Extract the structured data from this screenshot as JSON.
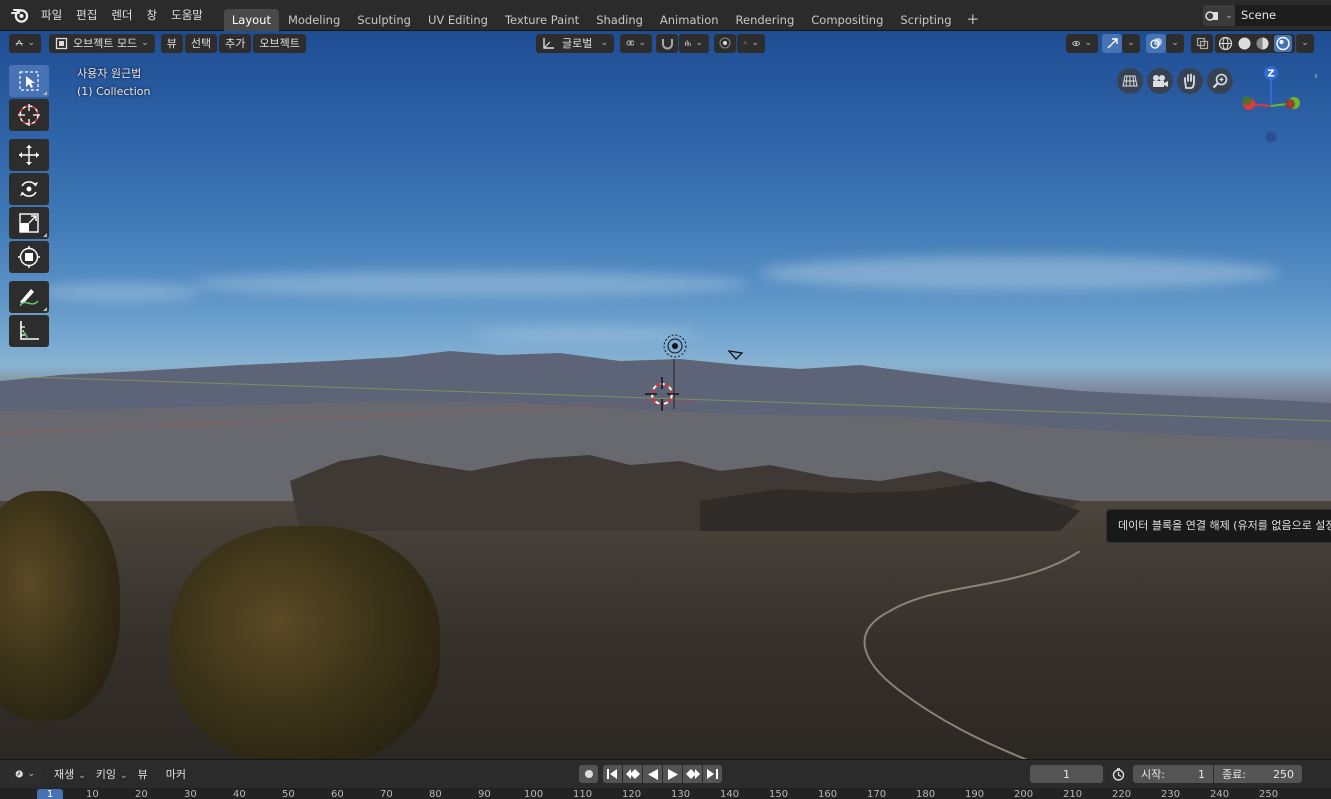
{
  "menu": {
    "items": [
      "파일",
      "편집",
      "렌더",
      "창",
      "도움말"
    ]
  },
  "workspaces": {
    "tabs": [
      "Layout",
      "Modeling",
      "Sculpting",
      "UV Editing",
      "Texture Paint",
      "Shading",
      "Animation",
      "Rendering",
      "Compositing",
      "Scripting"
    ],
    "active": "Layout",
    "add_label": "+"
  },
  "scene": {
    "name": "Scene"
  },
  "viewport_header": {
    "mode": "오브젝트 모드",
    "view": "뷰",
    "select": "선택",
    "add": "추가",
    "object": "오브젝트",
    "transform_orientation": "글로벌"
  },
  "viewport_overlay": {
    "view_name": "사용자 원근법",
    "collection": "(1) Collection"
  },
  "gizmo": {
    "z_label": "Z",
    "colors": {
      "x": "#e0383e",
      "y": "#6bb82b",
      "z": "#2f6ed6"
    }
  },
  "tooltip": {
    "text": "데이터 블록을 연결 해제 (유저를 없음으로 설정)"
  },
  "timeline": {
    "menu": {
      "playback": "재생",
      "keying": "키잉",
      "view": "뷰",
      "marker": "마커"
    },
    "current_frame": "1",
    "start_label": "시작:",
    "start": "1",
    "end_label": "종료:",
    "end": "250",
    "ruler_ticks": [
      "1",
      "10",
      "20",
      "30",
      "40",
      "50",
      "60",
      "70",
      "80",
      "90",
      "100",
      "110",
      "120",
      "130",
      "140",
      "150",
      "160",
      "170",
      "180",
      "190",
      "200",
      "210",
      "220",
      "230",
      "240",
      "250"
    ]
  },
  "accent_color": "#4772b3"
}
